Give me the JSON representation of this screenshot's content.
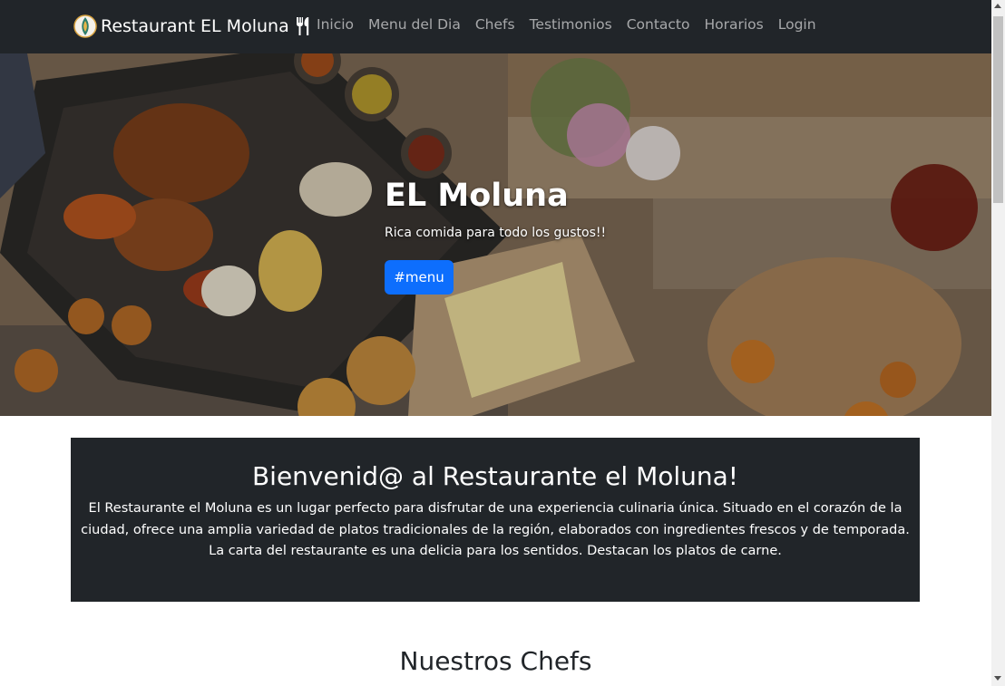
{
  "navbar": {
    "brand": "Restaurant EL Moluna",
    "brand_logo_icon": "restaurant-logo-icon",
    "brand_icon": "utensils-icon",
    "links": [
      "Inicio",
      "Menu del Dia",
      "Chefs",
      "Testimonios",
      "Contacto",
      "Horarios",
      "Login"
    ]
  },
  "hero": {
    "title": "EL Moluna",
    "subtitle": "Rica comida para todo los gustos!!",
    "button": "#menu"
  },
  "welcome": {
    "title": "Bienvenid@ al Restaurante el Moluna!",
    "text": "El Restaurante el Moluna es un lugar perfecto para disfrutar de una experiencia culinaria única. Situado en el corazón de la ciudad, ofrece una amplia variedad de platos tradicionales de la región, elaborados con ingredientes frescos y de temporada. La carta del restaurante es una delicia para los sentidos. Destacan los platos de carne."
  },
  "chefs": {
    "title": "Nuestros Chefs"
  },
  "colors": {
    "navbar_bg": "#212529",
    "primary": "#0d6efd",
    "welcome_bg": "#212529"
  }
}
